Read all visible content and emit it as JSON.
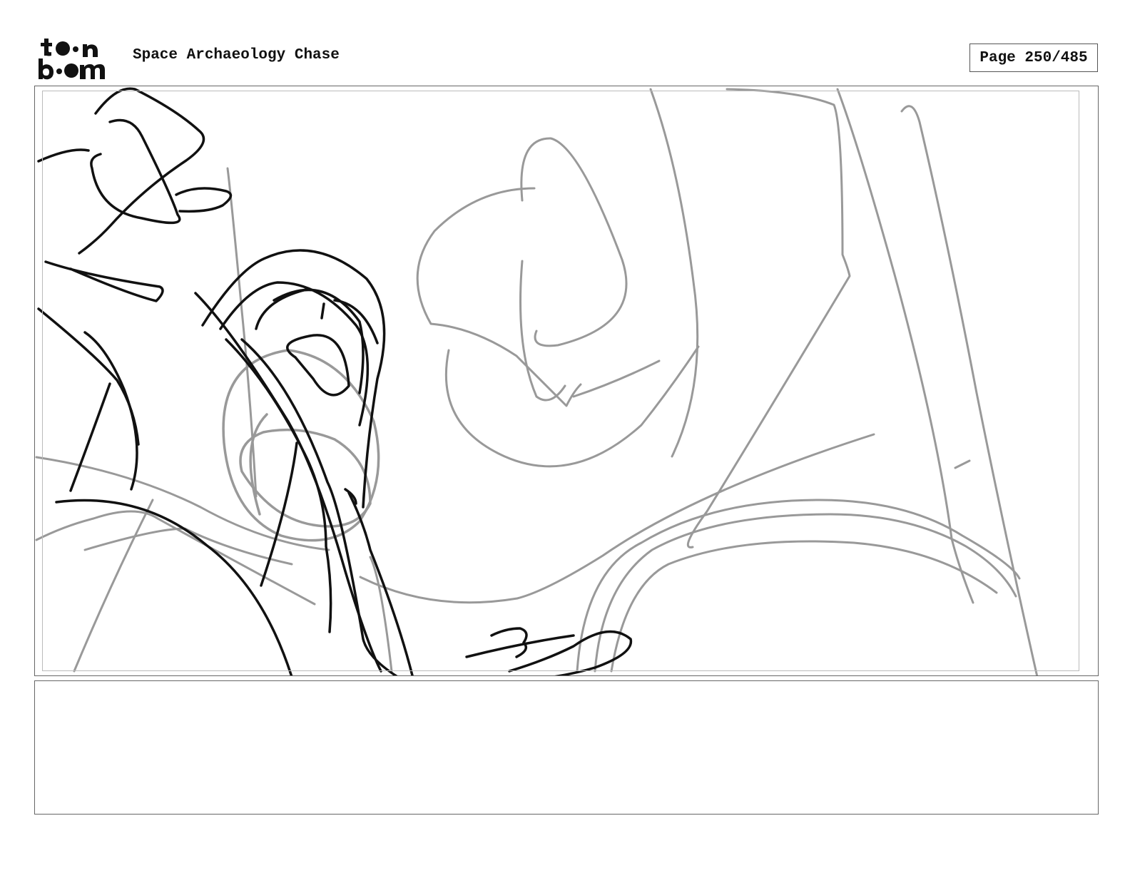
{
  "header": {
    "logo_text": "toon boom",
    "project_title": "Space Archaeology Chase",
    "page_label": "Page 250/485"
  },
  "panel": {
    "image": "rough-sketch"
  },
  "caption": {
    "text": ""
  },
  "colors": {
    "ink": "#111111",
    "construction_lines": "#999999",
    "frame": "#666666"
  }
}
